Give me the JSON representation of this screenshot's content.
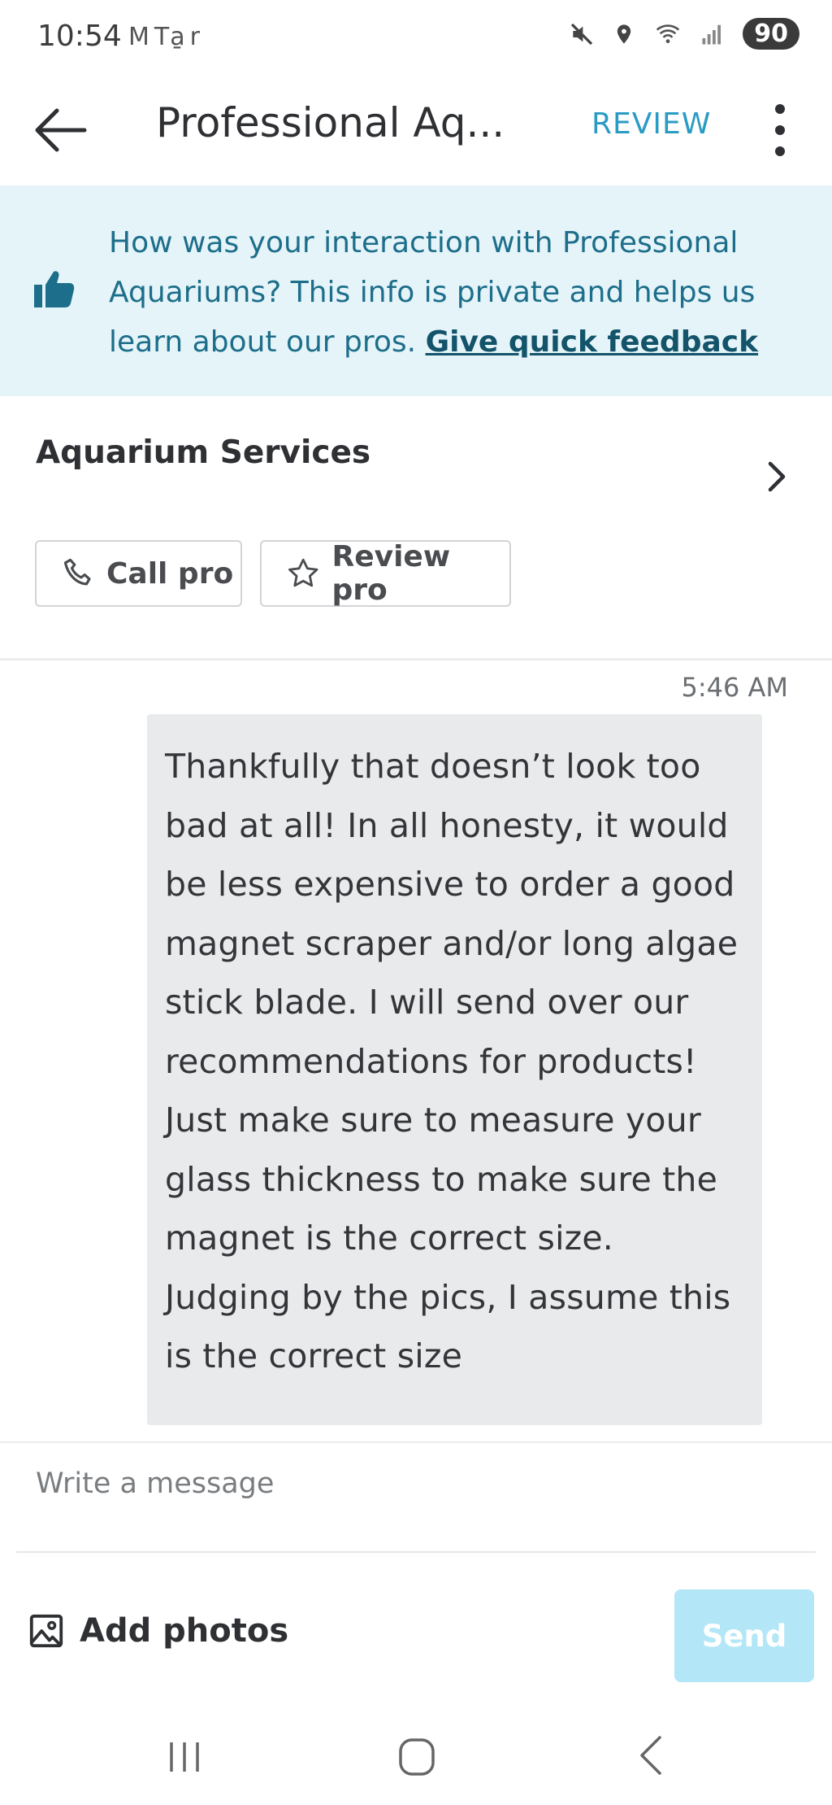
{
  "status_bar": {
    "time": "10:54",
    "app_icons": "M T a̱r",
    "battery": "90"
  },
  "header": {
    "title": "Professional Aq...",
    "review_label": "REVIEW"
  },
  "feedback_banner": {
    "text": "How was your interaction with Professional Aquariums? This info is private and helps us learn about our pros. ",
    "link_label": "Give quick feedback"
  },
  "service": {
    "title": "Aquarium Services",
    "call_label": "Call pro",
    "review_label": "Review pro"
  },
  "messages": [
    {
      "time": "5:46 AM",
      "text": "Thankfully that doesn’t look too bad at all! In all honesty, it would be less expensive to order a good magnet scraper and/or long algae stick blade. I will send over our recommendations for products! Just make sure to measure your glass thickness to make sure the magnet is the correct size. Judging by the pics, I assume this is the correct size"
    }
  ],
  "composer": {
    "placeholder": "Write a message",
    "value": "",
    "add_photos_label": "Add photos",
    "send_label": "Send"
  },
  "colors": {
    "accent": "#2a9bc4",
    "banner_bg": "#e5f4f9",
    "banner_text": "#1d6e8a",
    "bubble_bg": "#e8eaeb",
    "send_disabled": "#b3e7f7"
  }
}
